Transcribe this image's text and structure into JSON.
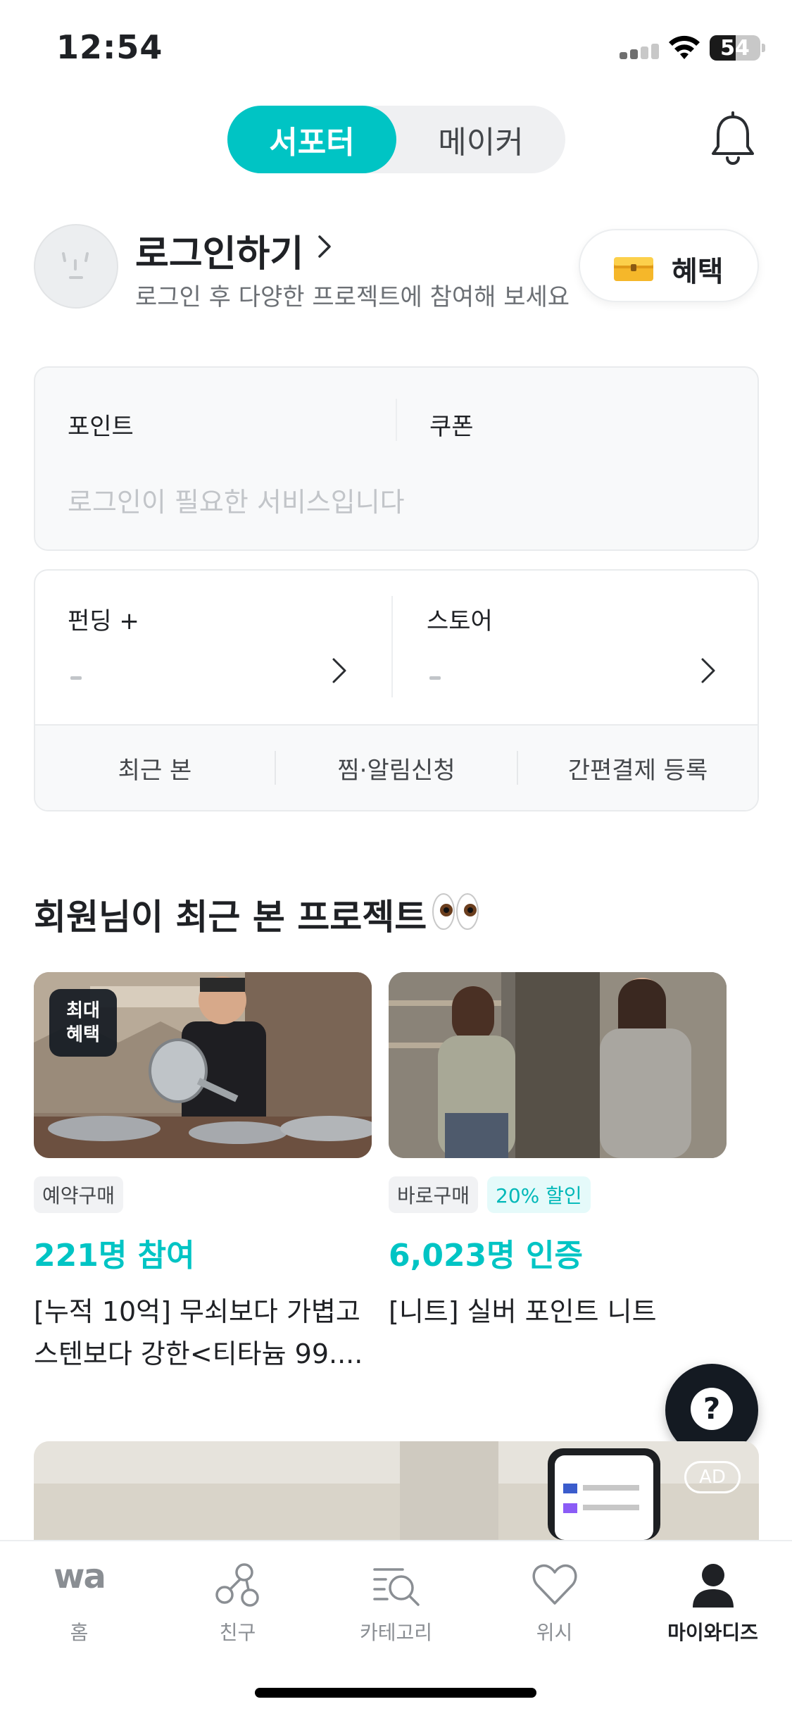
{
  "status_bar": {
    "time": "12:54",
    "battery": "54"
  },
  "mode_toggle": {
    "active": "서포터",
    "inactive": "메이커"
  },
  "profile": {
    "login_title": "로그인하기",
    "login_subtitle": "로그인 후 다양한 프로젝트에 참여해 보세요",
    "benefit_label": "혜택"
  },
  "points_card": {
    "points_label": "포인트",
    "coupon_label": "쿠폰",
    "empty_text": "로그인이 필요한 서비스입니다"
  },
  "funding_card": {
    "funding_label": "펀딩 +",
    "funding_value": "-",
    "store_label": "스토어",
    "store_value": "-",
    "shortcuts": [
      "최근 본",
      "찜·알림신청",
      "간편결제 등록"
    ]
  },
  "recent_section": {
    "title": "회원님이 최근 본 프로젝트",
    "items": [
      {
        "badge": "최대 혜택",
        "badge_line1": "최대",
        "badge_line2": "혜택",
        "tags": [
          "예약구매"
        ],
        "stat": "221명 참여",
        "title_line1": "[누적 10억] 무쇠보다 가볍고",
        "title_line2": "스텐보다 강한<티타늄 99...."
      },
      {
        "tags": [
          "바로구매",
          "20% 할인"
        ],
        "stat": "6,023명 인증",
        "title_line1": "[니트] 실버 포인트 니트"
      }
    ]
  },
  "ad": {
    "label": "AD"
  },
  "help": {
    "label": "?"
  },
  "tab_bar": {
    "tabs": [
      {
        "label": "홈",
        "icon": "wadiz-logo-icon"
      },
      {
        "label": "친구",
        "icon": "friends-icon"
      },
      {
        "label": "카테고리",
        "icon": "category-search-icon"
      },
      {
        "label": "위시",
        "icon": "heart-icon"
      },
      {
        "label": "마이와디즈",
        "icon": "person-icon"
      }
    ],
    "active_tab": "마이와디즈",
    "logo_text": "wa"
  },
  "colors": {
    "accent": "#00c4c4",
    "dark": "#141a22",
    "text": "#1f2125",
    "muted": "#8a8e93"
  }
}
